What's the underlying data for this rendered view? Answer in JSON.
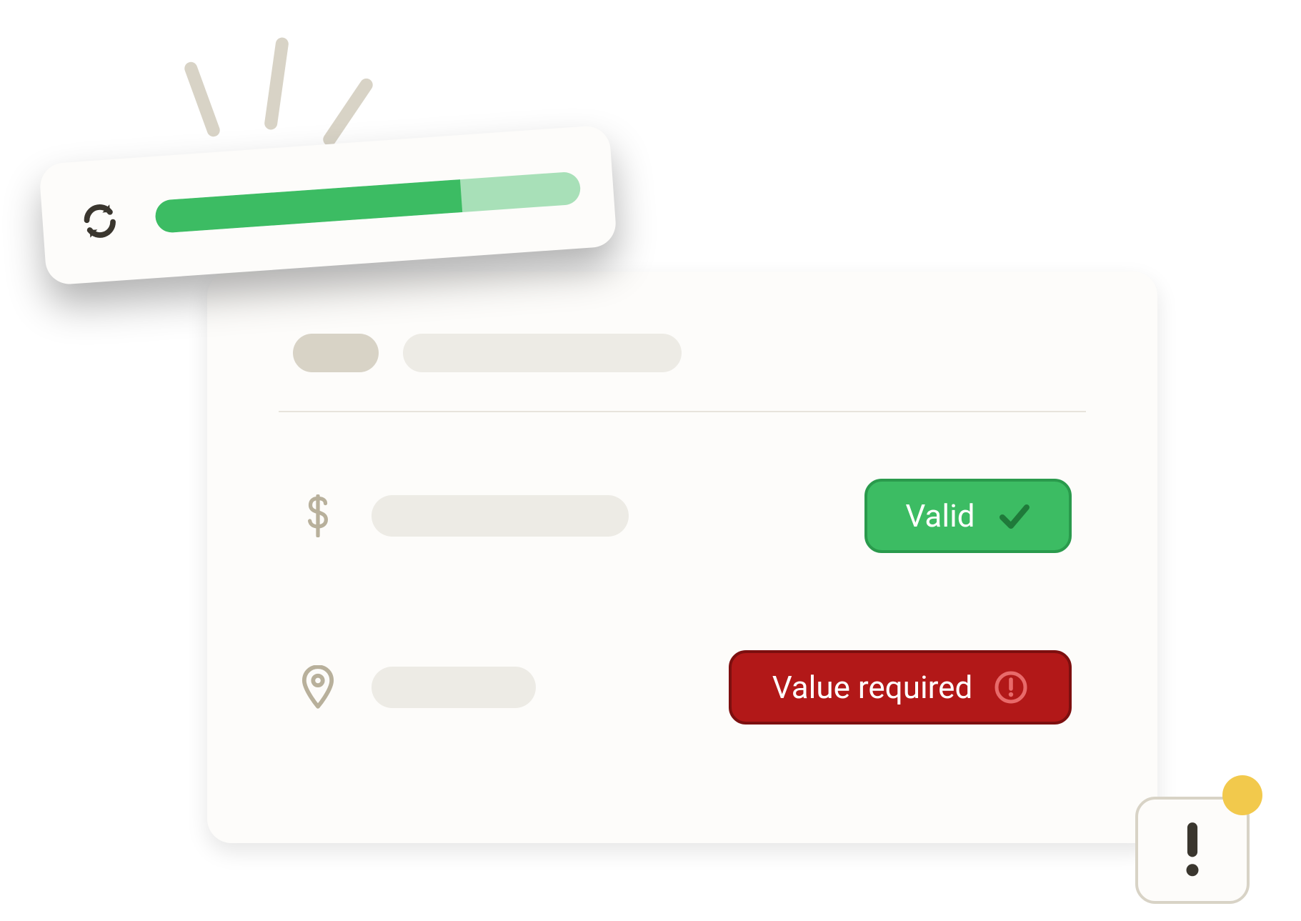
{
  "progress": {
    "percent": 72
  },
  "rows": [
    {
      "icon": "dollar",
      "status": {
        "kind": "valid",
        "label": "Valid"
      }
    },
    {
      "icon": "map-pin",
      "status": {
        "kind": "error",
        "label": "Value required"
      }
    }
  ],
  "colors": {
    "green": "#3cbc63",
    "green_dark": "#2a9a4c",
    "green_light": "#a8e0b8",
    "red": "#b21818",
    "red_dark": "#7d0f0f",
    "card_bg": "#fdfcfa",
    "placeholder": "#edebe5",
    "placeholder_dark": "#d8d3c6",
    "yellow": "#f2c94c"
  }
}
